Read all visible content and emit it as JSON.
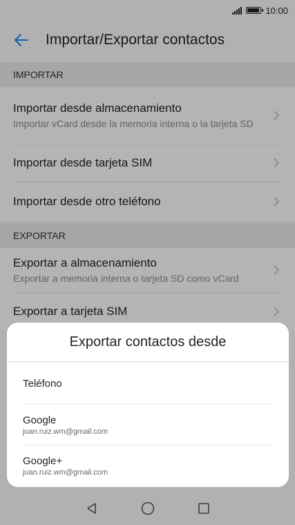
{
  "status": {
    "time": "10:00"
  },
  "appbar": {
    "title": "Importar/Exportar contactos"
  },
  "sections": {
    "import_header": "IMPORTAR",
    "export_header": "EXPORTAR"
  },
  "import_items": [
    {
      "title": "Importar desde almacenamiento",
      "subtitle": "Importar vCard desde la memoria interna o la tarjeta SD"
    },
    {
      "title": "Importar desde tarjeta SIM"
    },
    {
      "title": "Importar desde otro teléfono"
    }
  ],
  "export_items": [
    {
      "title": "Exportar a almacenamiento",
      "subtitle": "Exportar a memoria interna o tarjeta SD como vCard"
    },
    {
      "title": "Exportar a tarjeta SIM"
    }
  ],
  "dialog": {
    "title": "Exportar contactos desde",
    "options": [
      {
        "name": "Teléfono"
      },
      {
        "name": "Google",
        "account": "juan.ruiz.wm@gmail.com"
      },
      {
        "name": "Google+",
        "account": "juan.ruiz.wm@gmail.com"
      }
    ]
  },
  "colors": {
    "accent": "#1e88e5"
  },
  "icons": {
    "back": "arrow-back-icon",
    "chevron": "chevron-right-icon",
    "nav": [
      "back-triangle-icon",
      "home-circle-icon",
      "recents-square-icon"
    ]
  }
}
